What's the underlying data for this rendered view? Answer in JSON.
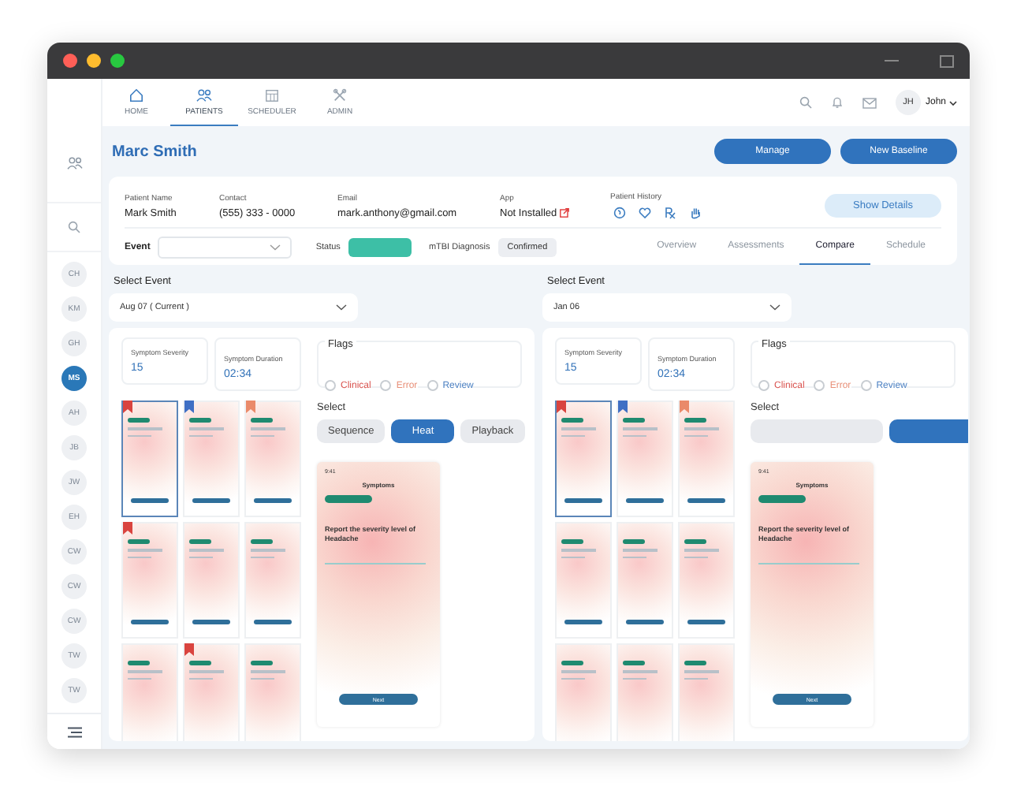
{
  "nav": {
    "tabs": [
      {
        "label": "HOME",
        "selected": false
      },
      {
        "label": "PATIENTS",
        "selected": true
      },
      {
        "label": "SCHEDULER",
        "selected": false
      },
      {
        "label": "ADMIN",
        "selected": false
      }
    ],
    "user": {
      "initials": "JH",
      "name": "John"
    }
  },
  "sidebar": {
    "patients": [
      {
        "initials": "CH",
        "selected": false
      },
      {
        "initials": "KM",
        "selected": false
      },
      {
        "initials": "GH",
        "selected": false
      },
      {
        "initials": "MS",
        "selected": true
      },
      {
        "initials": "AH",
        "selected": false
      },
      {
        "initials": "JB",
        "selected": false
      },
      {
        "initials": "JW",
        "selected": false
      },
      {
        "initials": "EH",
        "selected": false
      },
      {
        "initials": "CW",
        "selected": false
      },
      {
        "initials": "CW",
        "selected": false
      },
      {
        "initials": "CW",
        "selected": false
      },
      {
        "initials": "TW",
        "selected": false
      },
      {
        "initials": "TW",
        "selected": false
      }
    ]
  },
  "header": {
    "title": "Marc Smith",
    "buttons": [
      "Manage",
      "New Baseline"
    ]
  },
  "patient": {
    "fields": [
      {
        "label": "Patient Name",
        "value": "Mark Smith",
        "external": false
      },
      {
        "label": "Contact",
        "value": "(555) 333 - 0000",
        "external": false
      },
      {
        "label": "Email",
        "value": "mark.anthony@gmail.com",
        "external": false
      },
      {
        "label": "App",
        "value": "Not Installed",
        "external": true
      }
    ],
    "history_label": "Patient History",
    "show_details": "Show Details"
  },
  "event_bar": {
    "event_label": "Event",
    "status_label": "Status",
    "diagnosis_label": "mTBI Diagnosis",
    "diagnosis": "Confirmed",
    "tabs": [
      {
        "label": "Overview",
        "selected": false
      },
      {
        "label": "Assessments",
        "selected": false
      },
      {
        "label": "Compare",
        "selected": true
      },
      {
        "label": "Schedule",
        "selected": false
      }
    ]
  },
  "compare": [
    {
      "select_label": "Select Event",
      "event": "Aug 07 ( Current )",
      "metrics": [
        {
          "label": "Symptom Severity",
          "value": "15"
        },
        {
          "label": "Symptom Duration",
          "value": "02:34"
        }
      ],
      "flags_label": "Flags",
      "flags": [
        {
          "label": "Clinical",
          "checked": false,
          "color": "#d9534f"
        },
        {
          "label": "Error",
          "checked": false,
          "color": "#e8917a"
        },
        {
          "label": "Review",
          "checked": false,
          "color": "#4a7fc1"
        }
      ],
      "view_label": "Select",
      "views": [
        {
          "label": "Sequence",
          "selected": false
        },
        {
          "label": "Heat",
          "selected": true
        },
        {
          "label": "Playback",
          "selected": false
        }
      ],
      "thumbnails": [
        {
          "selected": true,
          "color": "#d9443f"
        },
        {
          "selected": false,
          "color": "#3f6fc4"
        },
        {
          "selected": false,
          "color": "#ea8a6a"
        },
        {
          "selected": false,
          "color": "#d9443f"
        },
        {
          "selected": false
        },
        {
          "selected": false
        },
        {
          "selected": false
        },
        {
          "selected": false,
          "color": "#d9443f"
        },
        {
          "selected": false
        }
      ],
      "preview": {
        "time": "9:41",
        "title": "Symptoms",
        "question": "Report the severity level of Headache",
        "button": "Next"
      }
    },
    {
      "select_label": "Select Event",
      "event": "Jan 06",
      "metrics": [
        {
          "label": "Symptom Severity",
          "value": "15"
        },
        {
          "label": "Symptom Duration",
          "value": "02:34"
        }
      ],
      "flags_label": "Flags",
      "flags": [
        {
          "label": "Clinical",
          "checked": false,
          "color": "#d9534f"
        },
        {
          "label": "Error",
          "checked": false,
          "color": "#e8917a"
        },
        {
          "label": "Review",
          "checked": false,
          "color": "#4a7fc1"
        }
      ],
      "view_label": "Select",
      "views": [
        {
          "selected": false
        },
        {
          "selected": true
        }
      ],
      "thumbnails": [
        {
          "selected": true,
          "color": "#d9443f"
        },
        {
          "selected": false,
          "color": "#3f6fc4"
        },
        {
          "selected": false,
          "color": "#ea8a6a"
        },
        {
          "selected": false
        },
        {
          "selected": false
        },
        {
          "selected": false
        },
        {
          "selected": false
        },
        {
          "selected": false
        },
        {
          "selected": false
        }
      ],
      "preview": {
        "time": "9:41",
        "title": "Symptoms",
        "question": "Report the severity level of Headache",
        "button": "Next"
      }
    }
  ]
}
